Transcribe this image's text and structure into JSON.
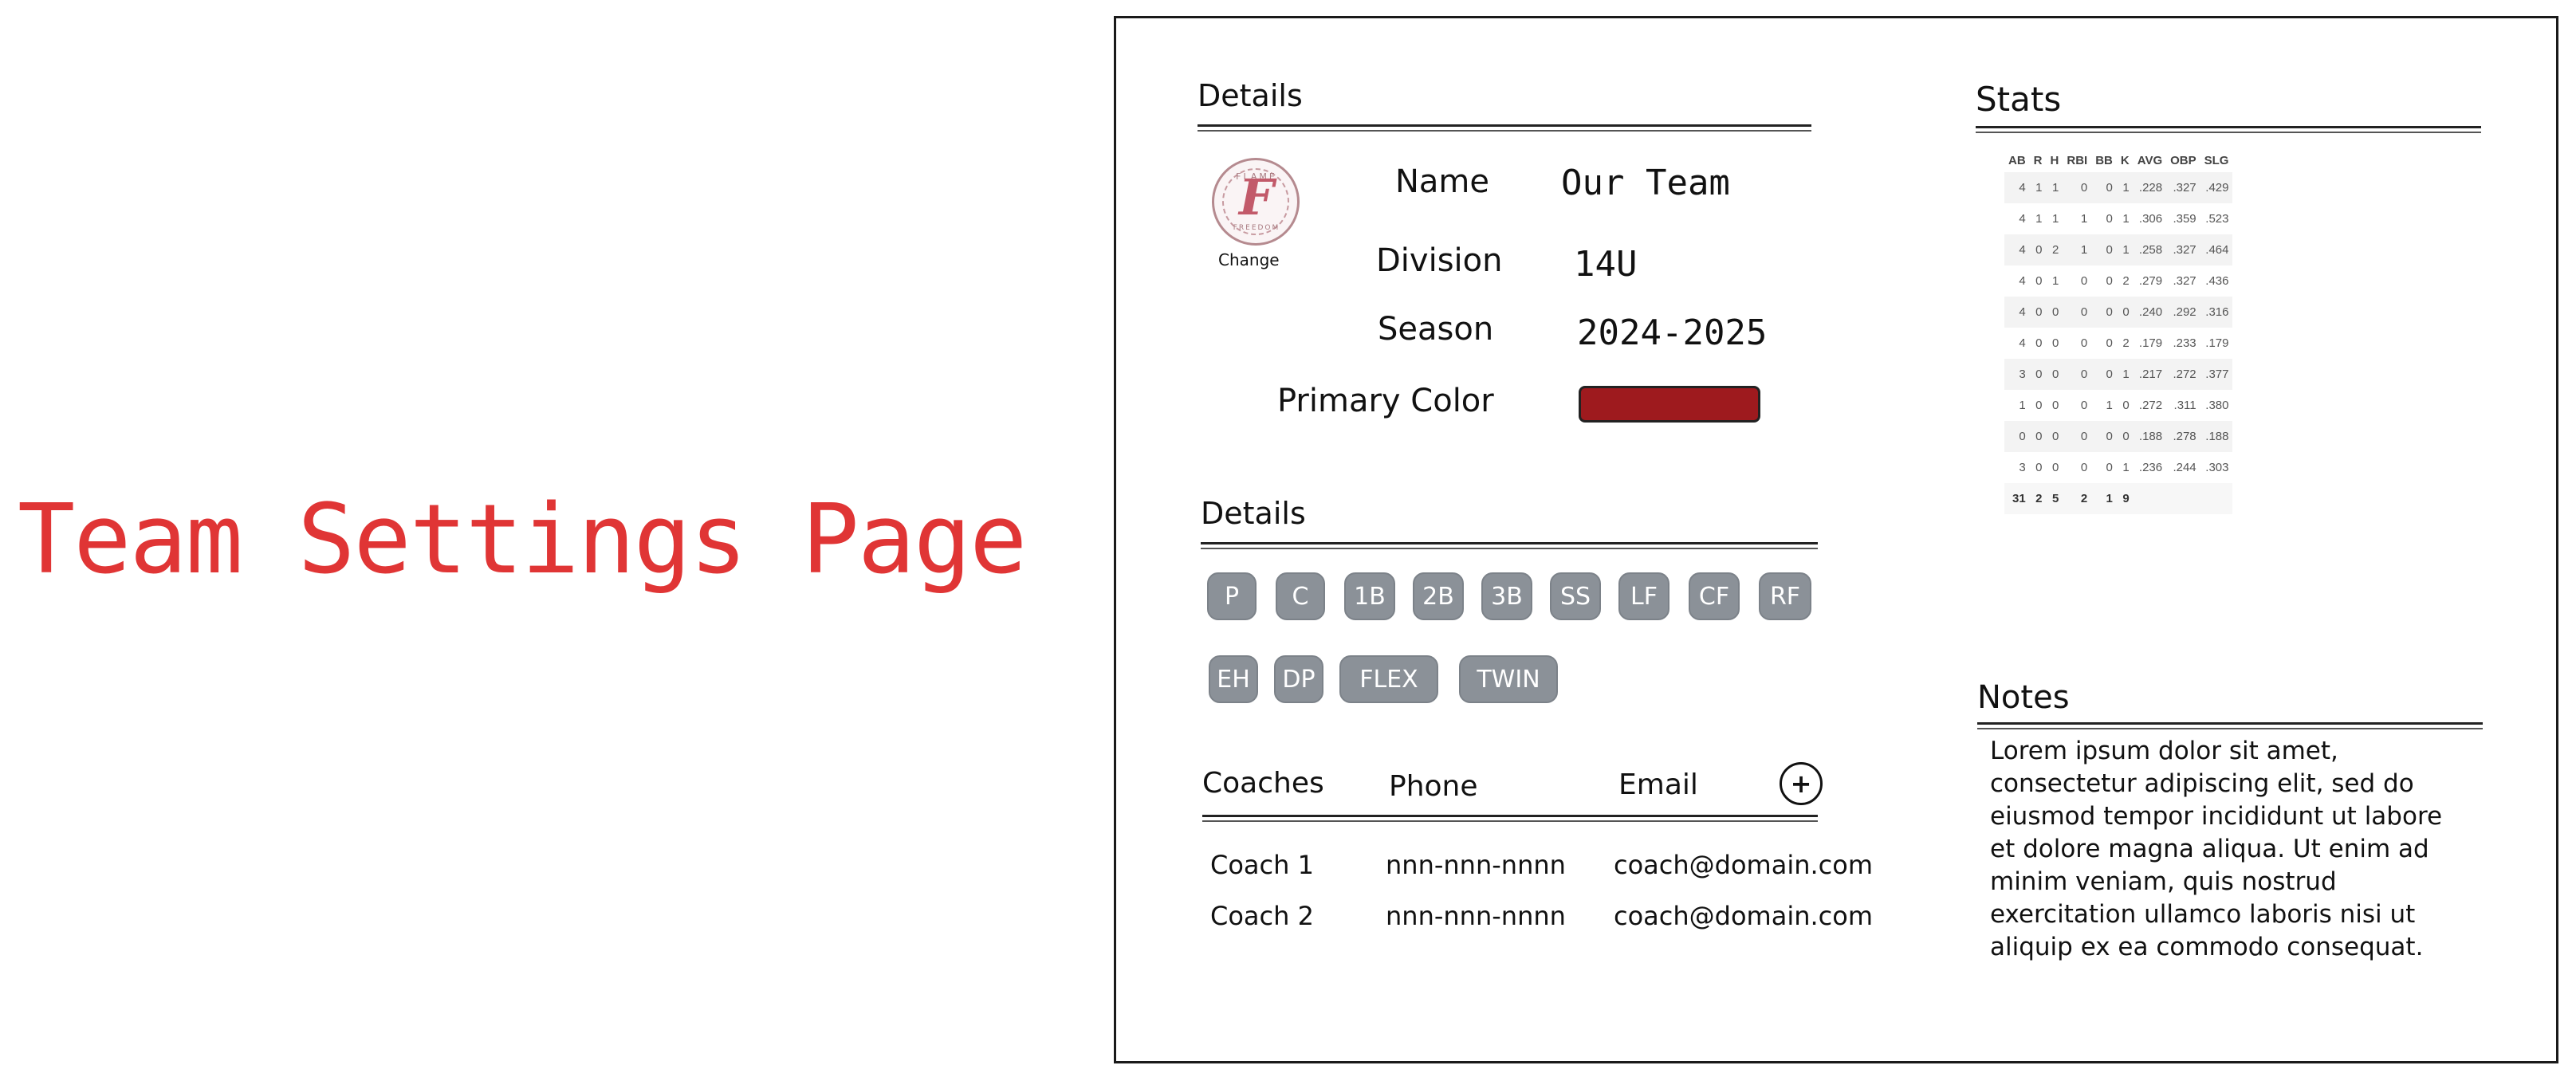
{
  "page": {
    "title": "Team Settings Page"
  },
  "details": {
    "title": "Details",
    "logo": {
      "text_top": "FLAME",
      "letter": "F",
      "text_bottom": "FREEDOM",
      "change_label": "Change"
    },
    "fields": {
      "name_label": "Name",
      "name_value": "Our Team",
      "division_label": "Division",
      "division_value": "14U",
      "season_label": "Season",
      "season_value": "2024-2025",
      "color_label": "Primary Color",
      "primary_color": "#9e1a1e"
    }
  },
  "positions": {
    "title": "Details",
    "chips": [
      "P",
      "C",
      "1B",
      "2B",
      "3B",
      "SS",
      "LF",
      "CF",
      "RF",
      "EH",
      "DP",
      "FLEX",
      "TWIN"
    ]
  },
  "coaches": {
    "headers": {
      "coach": "Coaches",
      "phone": "Phone",
      "email": "Email",
      "add": "+"
    },
    "rows": [
      {
        "name": "Coach 1",
        "phone": "nnn-nnn-nnnn",
        "email": "coach@domain.com"
      },
      {
        "name": "Coach 2",
        "phone": "nnn-nnn-nnnn",
        "email": "coach@domain.com"
      }
    ]
  },
  "stats": {
    "title": "Stats",
    "columns": [
      "AB",
      "R",
      "H",
      "RBI",
      "BB",
      "K",
      "AVG",
      "OBP",
      "SLG"
    ],
    "rows": [
      [
        "4",
        "1",
        "1",
        "0",
        "0",
        "1",
        ".228",
        ".327",
        ".429"
      ],
      [
        "4",
        "1",
        "1",
        "1",
        "0",
        "1",
        ".306",
        ".359",
        ".523"
      ],
      [
        "4",
        "0",
        "2",
        "1",
        "0",
        "1",
        ".258",
        ".327",
        ".464"
      ],
      [
        "4",
        "0",
        "1",
        "0",
        "0",
        "2",
        ".279",
        ".327",
        ".436"
      ],
      [
        "4",
        "0",
        "0",
        "0",
        "0",
        "0",
        ".240",
        ".292",
        ".316"
      ],
      [
        "4",
        "0",
        "0",
        "0",
        "0",
        "2",
        ".179",
        ".233",
        ".179"
      ],
      [
        "3",
        "0",
        "0",
        "0",
        "0",
        "1",
        ".217",
        ".272",
        ".377"
      ],
      [
        "1",
        "0",
        "0",
        "0",
        "1",
        "0",
        ".272",
        ".311",
        ".380"
      ],
      [
        "0",
        "0",
        "0",
        "0",
        "0",
        "0",
        ".188",
        ".278",
        ".188"
      ],
      [
        "3",
        "0",
        "0",
        "0",
        "0",
        "1",
        ".236",
        ".244",
        ".303"
      ]
    ],
    "totals": [
      "31",
      "2",
      "5",
      "2",
      "1",
      "9",
      "",
      "",
      ""
    ]
  },
  "notes": {
    "title": "Notes",
    "text": "Lorem ipsum dolor sit amet, consectetur adipiscing elit, sed do eiusmod tempor incididunt ut labore et dolore magna aliqua. Ut enim ad minim veniam, quis nostrud exercitation ullamco laboris nisi ut aliquip ex ea commodo consequat."
  },
  "colors": {
    "accent": "#e03535",
    "chip": "#8b9198",
    "primary_color": "#9e1a1e"
  }
}
